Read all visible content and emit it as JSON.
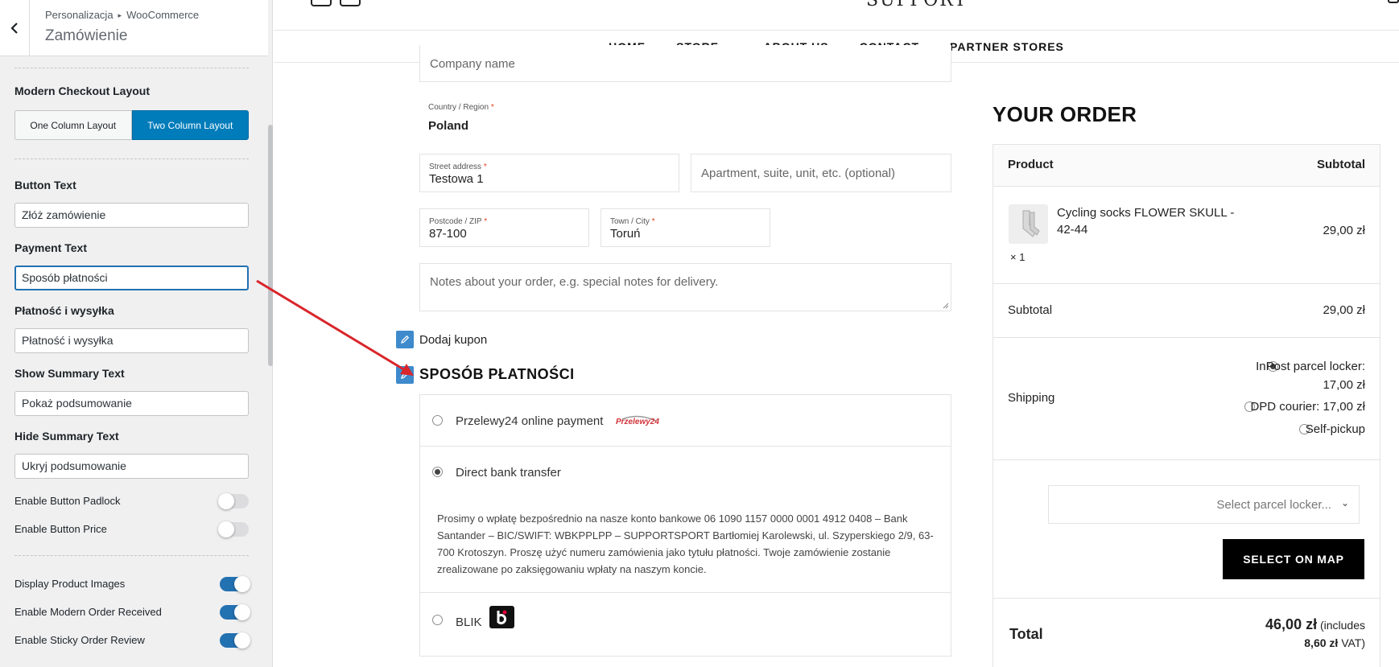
{
  "sidebar": {
    "breadcrumb": [
      "Personalizacja",
      "WooCommerce"
    ],
    "title": "Zamówienie",
    "layout": {
      "label": "Modern Checkout Layout",
      "options": [
        "One Column Layout",
        "Two Column Layout"
      ],
      "selected": "Two Column Layout"
    },
    "fields": [
      {
        "label": "Button Text",
        "value": "Złóż zamówienie"
      },
      {
        "label": "Payment Text",
        "value": "Sposób płatności"
      },
      {
        "label": "Płatność i wysyłka",
        "value": "Płatność i wysyłka"
      },
      {
        "label": "Show Summary Text",
        "value": "Pokaż podsumowanie"
      },
      {
        "label": "Hide Summary Text",
        "value": "Ukryj podsumowanie"
      }
    ],
    "toggles": [
      {
        "label": "Enable Button Padlock",
        "on": false
      },
      {
        "label": "Enable Button Price",
        "on": false
      },
      {
        "label": "Display Product Images",
        "on": true
      },
      {
        "label": "Enable Modern Order Received",
        "on": true
      },
      {
        "label": "Enable Sticky Order Review",
        "on": true
      }
    ],
    "accent": "#007cba"
  },
  "site": {
    "logo": "SUPPORT",
    "nav": [
      "HOME",
      "STORE",
      "ABOUT US",
      "CONTACT",
      "PARTNER STORES"
    ]
  },
  "checkout": {
    "company_placeholder": "Company name",
    "country": {
      "label": "Country / Region",
      "req": "*",
      "value": "Poland"
    },
    "street": {
      "label": "Street address",
      "req": "*",
      "value": "Testowa 1"
    },
    "apartment_placeholder": "Apartment, suite, unit, etc. (optional)",
    "postcode": {
      "label": "Postcode / ZIP",
      "req": "*",
      "value": "87-100"
    },
    "city": {
      "label": "Town / City",
      "req": "*",
      "value": "Toruń"
    },
    "notes_placeholder": "Notes about your order, e.g. special notes for delivery.",
    "coupon": "Dodaj kupon",
    "payment_title": "SPOSÓB PŁATNOŚCI",
    "payment_methods": [
      {
        "label": "Przelewy24 online payment",
        "logo_text": "Przelewy24",
        "selected": false
      },
      {
        "label": "Direct bank transfer",
        "selected": true
      },
      {
        "label": "BLIK",
        "selected": false
      }
    ],
    "bank_description": "Prosimy o wpłatę bezpośrednio na nasze konto bankowe 06 1090 1157 0000 0001 4912 0408 – Bank Santander – BIC/SWIFT: WBKPPLPP – SUPPORTSPORT Bartłomiej Karolewski, ul. Szyperskiego 2/9, 63-700 Krotoszyn. Proszę użyć numeru zamówienia jako tytułu płatności. Twoje zamówienie zostanie zrealizowane po zaksięgowaniu wpłaty na naszym koncie."
  },
  "order": {
    "title": "YOUR ORDER",
    "col_product": "Product",
    "col_subtotal": "Subtotal",
    "item_name_1": "Cycling socks FLOWER SKULL -",
    "item_name_2": "42-44",
    "item_qty": "× 1",
    "item_price": "29,00 zł",
    "subtotal_label": "Subtotal",
    "subtotal_value": "29,00 zł",
    "shipping_label": "Shipping",
    "shipping_options": [
      {
        "label": "InPost parcel locker:",
        "price": "17,00 zł",
        "selected": true
      },
      {
        "label": "DPD courier: 17,00 zł",
        "selected": false
      },
      {
        "label": "Self-pickup",
        "selected": false
      }
    ],
    "select_placeholder": "Select parcel locker...",
    "map_button": "SELECT ON MAP",
    "total_label": "Total",
    "total_value": "46,00 zł",
    "total_includes": "(includes",
    "vat_value": "8,60 zł",
    "vat_suffix": "VAT)"
  }
}
